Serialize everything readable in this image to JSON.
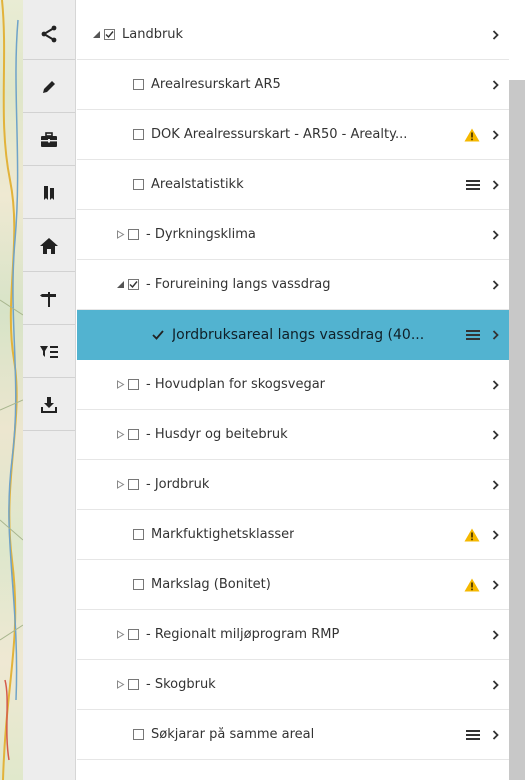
{
  "toolbar": {
    "tools": [
      {
        "name": "share",
        "icon": "share-icon"
      },
      {
        "name": "edit",
        "icon": "pencil-icon"
      },
      {
        "name": "toolbox",
        "icon": "briefcase-icon"
      },
      {
        "name": "bookmarks",
        "icon": "bookmark-icon"
      },
      {
        "name": "home",
        "icon": "home-icon"
      },
      {
        "name": "route",
        "icon": "signpost-icon"
      },
      {
        "name": "filter",
        "icon": "filter-list-icon"
      },
      {
        "name": "download",
        "icon": "download-icon"
      }
    ]
  },
  "layers": [
    {
      "label": "Landbruk",
      "level": 0,
      "expander": "expanded",
      "checked": true,
      "warning": false,
      "menu": false
    },
    {
      "label": "Arealresurskart AR5",
      "level": 2,
      "expander": "none",
      "checked": false,
      "warning": false,
      "menu": false
    },
    {
      "label": "DOK Arealressurskart - AR50 - Arealty...",
      "level": 2,
      "expander": "none",
      "checked": false,
      "warning": true,
      "menu": false
    },
    {
      "label": "Arealstatistikk",
      "level": 2,
      "expander": "none",
      "checked": false,
      "warning": false,
      "menu": true
    },
    {
      "label": "- Dyrkningsklima",
      "level": 1,
      "expander": "collapsed",
      "checked": false,
      "warning": false,
      "menu": false
    },
    {
      "label": "- Forureining langs vassdrag",
      "level": 1,
      "expander": "expanded",
      "checked": true,
      "warning": false,
      "menu": false
    },
    {
      "label": "Jordbruksareal langs vassdrag (40...",
      "level": 3,
      "expander": "none",
      "checked": true,
      "warning": false,
      "menu": true,
      "selected": true
    },
    {
      "label": "- Hovudplan for skogsvegar",
      "level": 1,
      "expander": "collapsed",
      "checked": false,
      "warning": false,
      "menu": false
    },
    {
      "label": "- Husdyr og beitebruk",
      "level": 1,
      "expander": "collapsed",
      "checked": false,
      "warning": false,
      "menu": false
    },
    {
      "label": "- Jordbruk",
      "level": 1,
      "expander": "collapsed",
      "checked": false,
      "warning": false,
      "menu": false
    },
    {
      "label": "Markfuktighetsklasser",
      "level": 2,
      "expander": "none",
      "checked": false,
      "warning": true,
      "menu": false
    },
    {
      "label": "Markslag (Bonitet)",
      "level": 2,
      "expander": "none",
      "checked": false,
      "warning": true,
      "menu": false
    },
    {
      "label": "- Regionalt miljøprogram RMP",
      "level": 1,
      "expander": "collapsed",
      "checked": false,
      "warning": false,
      "menu": false
    },
    {
      "label": "- Skogbruk",
      "level": 1,
      "expander": "collapsed",
      "checked": false,
      "warning": false,
      "menu": false
    },
    {
      "label": "Søkjarar på samme areal",
      "level": 2,
      "expander": "none",
      "checked": false,
      "warning": false,
      "menu": true
    }
  ],
  "colors": {
    "selected_row": "#52b3d0",
    "warning": "#f5b800",
    "toolbar_bg": "#ededed",
    "scrollbar": "#c8c8c8"
  }
}
